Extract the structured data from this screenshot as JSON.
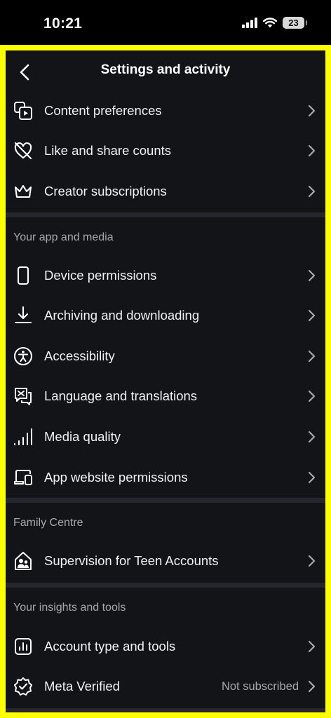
{
  "status_bar": {
    "time": "10:21",
    "battery": "23"
  },
  "header": {
    "title": "Settings and activity"
  },
  "top_items": [
    {
      "label": "Content preferences",
      "icon": "content-preferences-icon"
    },
    {
      "label": "Like and share counts",
      "icon": "heart-slash-icon"
    },
    {
      "label": "Creator subscriptions",
      "icon": "crown-icon"
    }
  ],
  "sections": {
    "app_media": {
      "title": "Your app and media",
      "items": [
        {
          "label": "Device permissions",
          "icon": "phone-icon"
        },
        {
          "label": "Archiving and downloading",
          "icon": "download-icon"
        },
        {
          "label": "Accessibility",
          "icon": "accessibility-icon"
        },
        {
          "label": "Language and translations",
          "icon": "translate-icon"
        },
        {
          "label": "Media quality",
          "icon": "signal-bars-icon"
        },
        {
          "label": "App website permissions",
          "icon": "devices-icon"
        }
      ]
    },
    "family": {
      "title": "Family Centre",
      "items": [
        {
          "label": "Supervision for Teen Accounts",
          "icon": "home-people-icon"
        }
      ]
    },
    "insights": {
      "title": "Your insights and tools",
      "items": [
        {
          "label": "Account type and tools",
          "icon": "chart-icon"
        },
        {
          "label": "Meta Verified",
          "icon": "verified-badge-icon",
          "trailing": "Not subscribed"
        }
      ]
    }
  },
  "colors": {
    "highlight_border": "#ffff00",
    "background": "#121418",
    "divider": "#24272c",
    "secondary_text": "#a8a8ad"
  }
}
